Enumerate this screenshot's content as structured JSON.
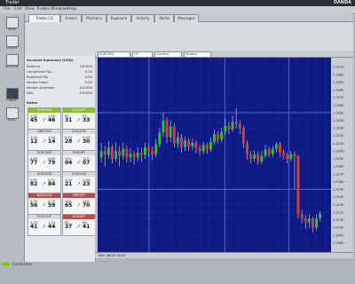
{
  "window": {
    "title": "Trader",
    "brand": "OANDA"
  },
  "menu": [
    "File",
    "Edit",
    "View",
    "Trades",
    "Windows",
    "Help"
  ],
  "sidebar": {
    "items": [
      {
        "label": "Trade",
        "icon": "trade-icon"
      },
      {
        "label": "Orders",
        "icon": "orders-icon"
      },
      {
        "label": "Account",
        "icon": "account-icon"
      },
      {
        "label": "Charts",
        "icon": "chart-icon"
      },
      {
        "label": "Tools",
        "icon": "tools-icon"
      }
    ]
  },
  "tabs": [
    "Trades (1)",
    "Orders",
    "Positions",
    "Exposure",
    "Activity",
    "Alerts",
    "Messages"
  ],
  "account": {
    "title": "Account Summary (USD)",
    "rows": [
      {
        "label": "Balance",
        "value": "100000"
      },
      {
        "label": "Unrealized P&L",
        "value": "0.00"
      },
      {
        "label": "Realized P&L",
        "value": "0.00"
      },
      {
        "label": "Margin Used",
        "value": "0.00"
      },
      {
        "label": "Margin Available",
        "value": "100000"
      },
      {
        "label": "NAV",
        "value": "100000"
      }
    ],
    "rate_header": "Rates"
  },
  "rate_tiles": [
    {
      "pair": "EUR/USD",
      "status": "g",
      "bid": "1.32",
      "bid_big": "45",
      "ask": "1.32",
      "ask_big": "46"
    },
    {
      "pair": "USD/JPY",
      "status": "g",
      "bid": "97.",
      "bid_big": "31",
      "ask": "97.",
      "ask_big": "33"
    },
    {
      "pair": "GBP/USD",
      "status": "n",
      "bid": "1.54",
      "bid_big": "12",
      "ask": "1.54",
      "ask_big": "14"
    },
    {
      "pair": "USD/CHF",
      "status": "n",
      "bid": "0.93",
      "bid_big": "28",
      "ask": "0.93",
      "ask_big": "30"
    },
    {
      "pair": "EUR/GBP",
      "status": "n",
      "bid": "0.85",
      "bid_big": "77",
      "ask": "0.85",
      "ask_big": "79"
    },
    {
      "pair": "EUR/JPY",
      "status": "n",
      "bid": "129.",
      "bid_big": "04",
      "ask": "129.",
      "ask_big": "07"
    },
    {
      "pair": "AUD/USD",
      "status": "n",
      "bid": "0.91",
      "bid_big": "82",
      "ask": "0.91",
      "ask_big": "84"
    },
    {
      "pair": "USD/CAD",
      "status": "n",
      "bid": "1.04",
      "bid_big": "21",
      "ask": "1.04",
      "ask_big": "23"
    },
    {
      "pair": "NZD/USD",
      "status": "r",
      "bid": "0.79",
      "bid_big": "56",
      "ask": "0.79",
      "ask_big": "59"
    },
    {
      "pair": "GBP/JPY",
      "status": "r",
      "bid": "149.",
      "bid_big": "65",
      "ask": "149.",
      "ask_big": "70"
    },
    {
      "pair": "EUR/CHF",
      "status": "n",
      "bid": "1.23",
      "bid_big": "41",
      "ask": "1.23",
      "ask_big": "44"
    },
    {
      "pair": "AUD/JPY",
      "status": "r",
      "bid": "89.",
      "bid_big": "37",
      "ask": "89.",
      "ask_big": "41"
    }
  ],
  "chart_toolbar": {
    "instrument": "EUR/USD",
    "granularity": "H1",
    "type": "Candles",
    "studies": "Studies"
  },
  "chart_bottom": {
    "label": "Mon 06/24 14:00"
  },
  "chart_data": {
    "type": "candlestick",
    "colors": {
      "background": "#0f1a86",
      "up": "#2fbf3a",
      "down": "#e23b2c",
      "grid": "#3f7ad6",
      "wick": "#d8d8d8"
    },
    "ylim": [
      1.3068,
      1.3322
    ],
    "y_ticks": [
      "1.3310",
      "1.3300",
      "1.3290",
      "1.3280",
      "1.3270",
      "1.3260",
      "1.3250",
      "1.3240",
      "1.3230",
      "1.3220",
      "1.3210",
      "1.3200",
      "1.3190",
      "1.3180",
      "1.3170",
      "1.3160",
      "1.3150",
      "1.3140",
      "1.3130",
      "1.3120",
      "1.3110",
      "1.3100",
      "1.3090",
      "1.3080"
    ],
    "candles": [
      {
        "o": 1.3192,
        "c": 1.32,
        "h": 1.321,
        "l": 1.3185
      },
      {
        "o": 1.32,
        "c": 1.3195,
        "h": 1.3207,
        "l": 1.318
      },
      {
        "o": 1.3195,
        "c": 1.3205,
        "h": 1.3213,
        "l": 1.319
      },
      {
        "o": 1.3205,
        "c": 1.319,
        "h": 1.3208,
        "l": 1.3184
      },
      {
        "o": 1.319,
        "c": 1.32,
        "h": 1.3212,
        "l": 1.3186
      },
      {
        "o": 1.32,
        "c": 1.3194,
        "h": 1.3206,
        "l": 1.318
      },
      {
        "o": 1.3194,
        "c": 1.3203,
        "h": 1.3211,
        "l": 1.3189
      },
      {
        "o": 1.3203,
        "c": 1.3192,
        "h": 1.3207,
        "l": 1.3185
      },
      {
        "o": 1.3192,
        "c": 1.3196,
        "h": 1.3204,
        "l": 1.3185
      },
      {
        "o": 1.3196,
        "c": 1.3192,
        "h": 1.32,
        "l": 1.3182
      },
      {
        "o": 1.3192,
        "c": 1.3198,
        "h": 1.3205,
        "l": 1.3187
      },
      {
        "o": 1.3198,
        "c": 1.3195,
        "h": 1.3204,
        "l": 1.3186
      },
      {
        "o": 1.3195,
        "c": 1.3205,
        "h": 1.3211,
        "l": 1.319
      },
      {
        "o": 1.3205,
        "c": 1.32,
        "h": 1.3209,
        "l": 1.3192
      },
      {
        "o": 1.32,
        "c": 1.3196,
        "h": 1.3206,
        "l": 1.3188
      },
      {
        "o": 1.3196,
        "c": 1.3209,
        "h": 1.3216,
        "l": 1.3192
      },
      {
        "o": 1.3209,
        "c": 1.3224,
        "h": 1.323,
        "l": 1.3205
      },
      {
        "o": 1.3224,
        "c": 1.324,
        "h": 1.325,
        "l": 1.3218
      },
      {
        "o": 1.324,
        "c": 1.3218,
        "h": 1.3244,
        "l": 1.321
      },
      {
        "o": 1.3218,
        "c": 1.3232,
        "h": 1.324,
        "l": 1.3212
      },
      {
        "o": 1.3232,
        "c": 1.321,
        "h": 1.3236,
        "l": 1.3205
      },
      {
        "o": 1.321,
        "c": 1.3218,
        "h": 1.3225,
        "l": 1.3204
      },
      {
        "o": 1.3218,
        "c": 1.3205,
        "h": 1.3222,
        "l": 1.3198
      },
      {
        "o": 1.3205,
        "c": 1.3214,
        "h": 1.3219,
        "l": 1.32
      },
      {
        "o": 1.3214,
        "c": 1.3206,
        "h": 1.3217,
        "l": 1.32
      },
      {
        "o": 1.3206,
        "c": 1.3211,
        "h": 1.3216,
        "l": 1.3202
      },
      {
        "o": 1.3211,
        "c": 1.3204,
        "h": 1.3214,
        "l": 1.3197
      },
      {
        "o": 1.3204,
        "c": 1.32,
        "h": 1.3208,
        "l": 1.3194
      },
      {
        "o": 1.32,
        "c": 1.3208,
        "h": 1.3212,
        "l": 1.3196
      },
      {
        "o": 1.3208,
        "c": 1.3202,
        "h": 1.3211,
        "l": 1.3196
      },
      {
        "o": 1.3202,
        "c": 1.3212,
        "h": 1.3218,
        "l": 1.3199
      },
      {
        "o": 1.3212,
        "c": 1.3222,
        "h": 1.3228,
        "l": 1.3208
      },
      {
        "o": 1.3222,
        "c": 1.3215,
        "h": 1.3226,
        "l": 1.321
      },
      {
        "o": 1.3215,
        "c": 1.3225,
        "h": 1.323,
        "l": 1.3211
      },
      {
        "o": 1.3225,
        "c": 1.3233,
        "h": 1.3243,
        "l": 1.3221
      },
      {
        "o": 1.3233,
        "c": 1.3228,
        "h": 1.3238,
        "l": 1.3222
      },
      {
        "o": 1.3228,
        "c": 1.3238,
        "h": 1.3247,
        "l": 1.3225
      },
      {
        "o": 1.3238,
        "c": 1.3235,
        "h": 1.3256,
        "l": 1.323
      },
      {
        "o": 1.3235,
        "c": 1.323,
        "h": 1.324,
        "l": 1.3222
      },
      {
        "o": 1.323,
        "c": 1.321,
        "h": 1.3233,
        "l": 1.3204
      },
      {
        "o": 1.321,
        "c": 1.3195,
        "h": 1.3214,
        "l": 1.3189
      },
      {
        "o": 1.3195,
        "c": 1.319,
        "h": 1.32,
        "l": 1.3184
      },
      {
        "o": 1.319,
        "c": 1.3196,
        "h": 1.3201,
        "l": 1.3186
      },
      {
        "o": 1.3196,
        "c": 1.3186,
        "h": 1.3199,
        "l": 1.3182
      },
      {
        "o": 1.3186,
        "c": 1.3194,
        "h": 1.32,
        "l": 1.3183
      },
      {
        "o": 1.3194,
        "c": 1.3202,
        "h": 1.3208,
        "l": 1.319
      },
      {
        "o": 1.3202,
        "c": 1.3196,
        "h": 1.3206,
        "l": 1.3192
      },
      {
        "o": 1.3196,
        "c": 1.3203,
        "h": 1.3207,
        "l": 1.3192
      },
      {
        "o": 1.3203,
        "c": 1.3209,
        "h": 1.3212,
        "l": 1.3198
      },
      {
        "o": 1.3209,
        "c": 1.3198,
        "h": 1.3212,
        "l": 1.3192
      },
      {
        "o": 1.3198,
        "c": 1.3194,
        "h": 1.3202,
        "l": 1.3189
      },
      {
        "o": 1.3194,
        "c": 1.319,
        "h": 1.3198,
        "l": 1.3184
      },
      {
        "o": 1.319,
        "c": 1.3196,
        "h": 1.32,
        "l": 1.3187
      },
      {
        "o": 1.3196,
        "c": 1.3193,
        "h": 1.3199,
        "l": 1.315
      },
      {
        "o": 1.3193,
        "c": 1.3118,
        "h": 1.3195,
        "l": 1.3112
      },
      {
        "o": 1.3118,
        "c": 1.3112,
        "h": 1.3124,
        "l": 1.3105
      },
      {
        "o": 1.3112,
        "c": 1.3107,
        "h": 1.3116,
        "l": 1.3098
      },
      {
        "o": 1.3107,
        "c": 1.3112,
        "h": 1.3117,
        "l": 1.31
      },
      {
        "o": 1.3112,
        "c": 1.31,
        "h": 1.3114,
        "l": 1.3094
      },
      {
        "o": 1.31,
        "c": 1.3112,
        "h": 1.3117,
        "l": 1.3096
      },
      {
        "o": 1.3112,
        "c": 1.3118,
        "h": 1.3122,
        "l": 1.3108
      }
    ]
  },
  "status": {
    "text": "Connected"
  }
}
